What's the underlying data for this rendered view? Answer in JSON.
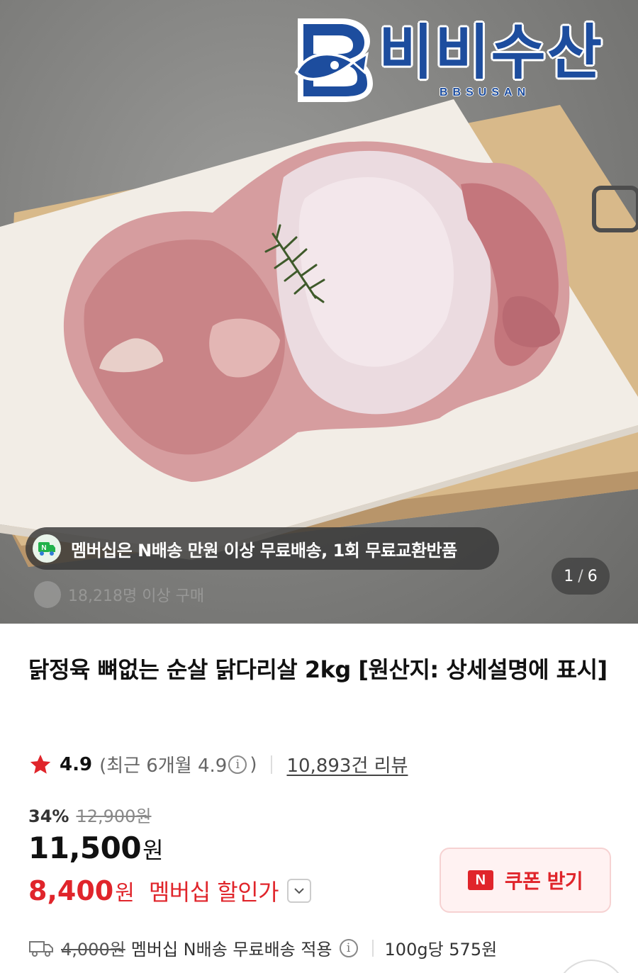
{
  "brand": {
    "name": "비비수산",
    "subname": "BBSUSAN"
  },
  "hero": {
    "membership_banner": "멤버십은 N배송 만원 이상 무료배송, 1회 무료교환반품",
    "buyers_text": "18,218명 이상 구매",
    "counter": {
      "current": "1",
      "total": "6"
    }
  },
  "product": {
    "title": "닭정육 뼈없는 순살 닭다리살 2kg [원산지: 상세설명에 표시]",
    "rating": {
      "score": "4.9",
      "recent_prefix": "(최근 6개월 4.9",
      "recent_suffix": ")",
      "reviews": "10,893건 리뷰"
    },
    "discount_rate": "34%",
    "original_price": "12,900원",
    "price": "11,500",
    "price_unit": "원",
    "member_price": "8,400",
    "member_price_unit": "원",
    "member_price_label": "멤버십 할인가",
    "coupon": {
      "badge": "N",
      "label": "쿠폰 받기"
    },
    "shipping": {
      "original_fee": "4,000원",
      "note": "멤버십 N배송 무료배송 적용",
      "unit_price": "100g당 575원"
    }
  },
  "colors": {
    "accent_red": "#e0252b",
    "brand_blue": "#1d4d9e"
  }
}
